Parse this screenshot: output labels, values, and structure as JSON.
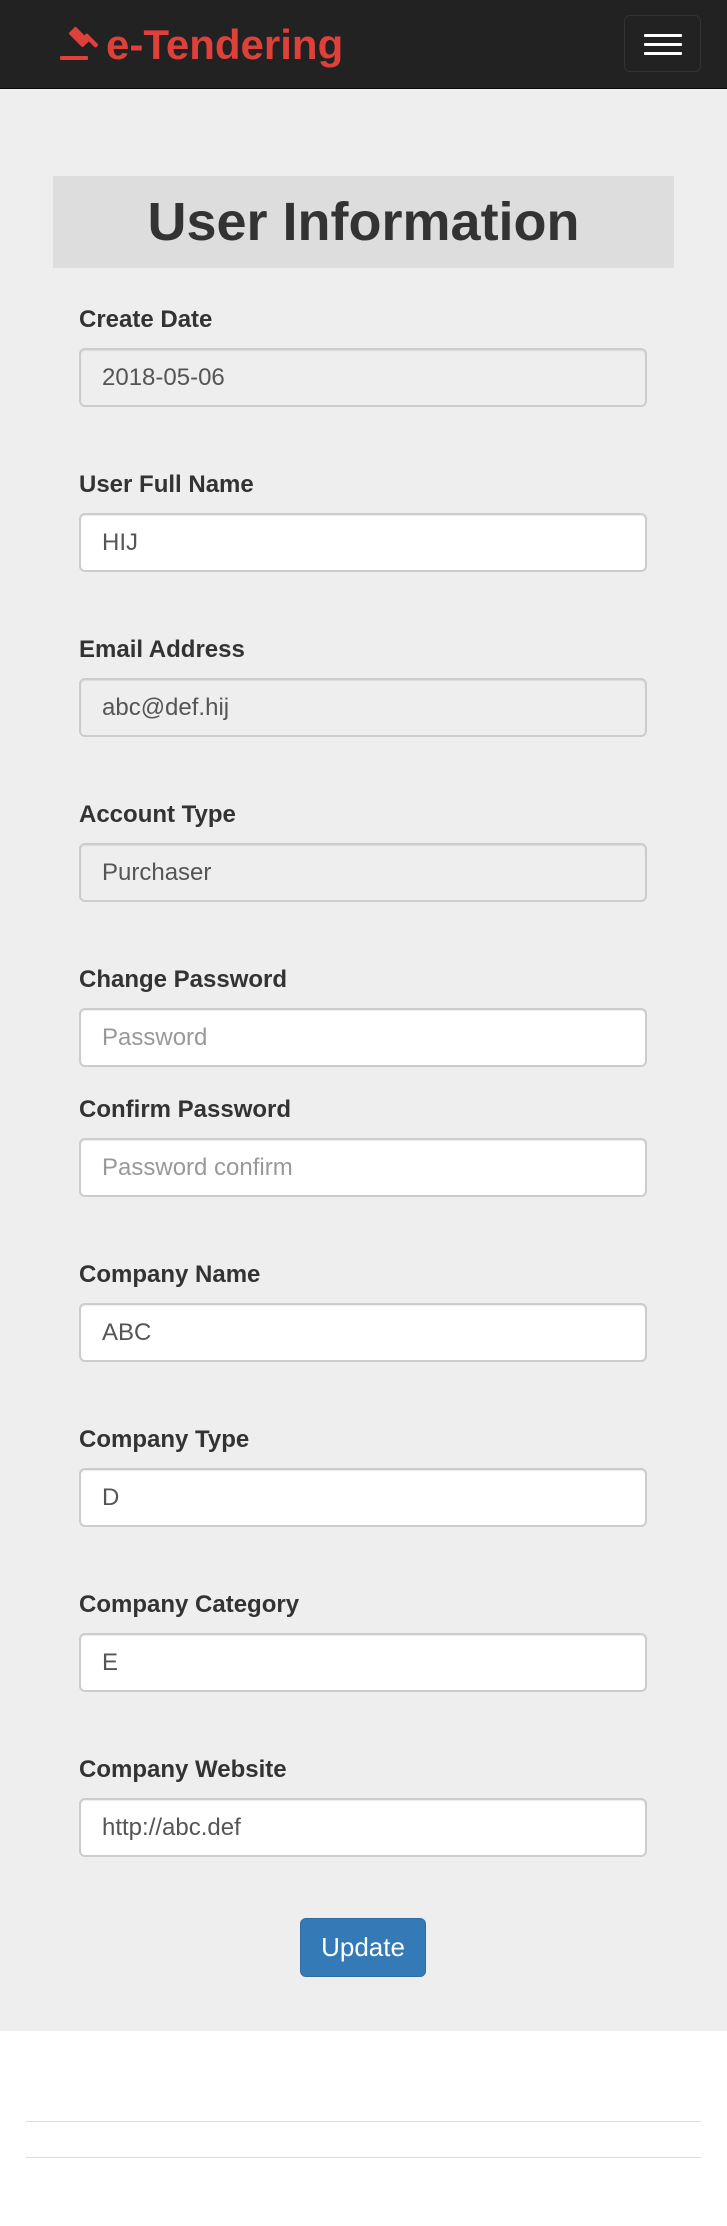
{
  "navbar": {
    "brand": "e-Tendering",
    "brand_icon": "gavel-icon",
    "brand_color": "#e0403a",
    "toggle_icon": "hamburger-menu-icon"
  },
  "form": {
    "heading": "User Information",
    "create_date": {
      "label": "Create Date",
      "value": "2018-05-06"
    },
    "full_name": {
      "label": "User Full Name",
      "value": "HIJ"
    },
    "email": {
      "label": "Email Address",
      "value": "abc@def.hij"
    },
    "account_type": {
      "label": "Account Type",
      "value": "Purchaser"
    },
    "change_password": {
      "label": "Change Password",
      "placeholder": "Password"
    },
    "confirm_password": {
      "label": "Confirm Password",
      "placeholder": "Password confirm"
    },
    "company_name": {
      "label": "Company Name",
      "value": "ABC"
    },
    "company_type": {
      "label": "Company Type",
      "value": "D"
    },
    "company_category": {
      "label": "Company Category",
      "value": "E"
    },
    "company_website": {
      "label": "Company Website",
      "value": "http://abc.def"
    },
    "update_label": "Update",
    "button_color": "#337ab7"
  }
}
